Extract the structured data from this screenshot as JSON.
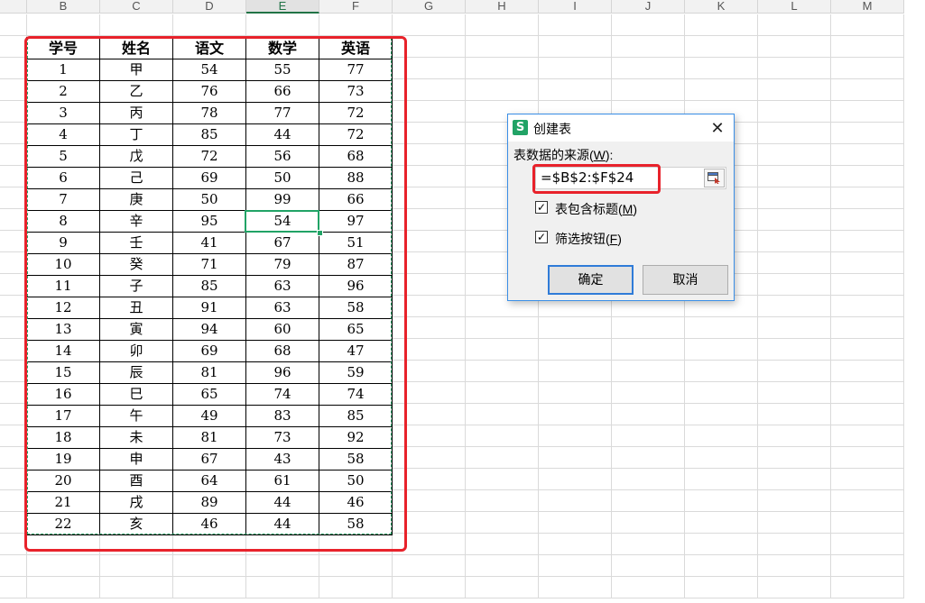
{
  "columns": [
    "B",
    "C",
    "D",
    "E",
    "F",
    "G",
    "H",
    "I",
    "J",
    "K",
    "L",
    "M"
  ],
  "active_column": "E",
  "table": {
    "headers": [
      "学号",
      "姓名",
      "语文",
      "数学",
      "英语"
    ],
    "rows": [
      [
        "1",
        "甲",
        "54",
        "55",
        "77"
      ],
      [
        "2",
        "乙",
        "76",
        "66",
        "73"
      ],
      [
        "3",
        "丙",
        "78",
        "77",
        "72"
      ],
      [
        "4",
        "丁",
        "85",
        "44",
        "72"
      ],
      [
        "5",
        "戊",
        "72",
        "56",
        "68"
      ],
      [
        "6",
        "己",
        "69",
        "50",
        "88"
      ],
      [
        "7",
        "庚",
        "50",
        "99",
        "66"
      ],
      [
        "8",
        "辛",
        "95",
        "54",
        "97"
      ],
      [
        "9",
        "壬",
        "41",
        "67",
        "51"
      ],
      [
        "10",
        "癸",
        "71",
        "79",
        "87"
      ],
      [
        "11",
        "子",
        "85",
        "63",
        "96"
      ],
      [
        "12",
        "丑",
        "91",
        "63",
        "58"
      ],
      [
        "13",
        "寅",
        "94",
        "60",
        "65"
      ],
      [
        "14",
        "卯",
        "69",
        "68",
        "47"
      ],
      [
        "15",
        "辰",
        "81",
        "96",
        "59"
      ],
      [
        "16",
        "巳",
        "65",
        "74",
        "74"
      ],
      [
        "17",
        "午",
        "49",
        "83",
        "85"
      ],
      [
        "18",
        "未",
        "81",
        "73",
        "92"
      ],
      [
        "19",
        "申",
        "67",
        "43",
        "58"
      ],
      [
        "20",
        "酉",
        "64",
        "61",
        "50"
      ],
      [
        "21",
        "戌",
        "89",
        "44",
        "46"
      ],
      [
        "22",
        "亥",
        "46",
        "44",
        "58"
      ]
    ]
  },
  "dialog": {
    "title": "创建表",
    "app_icon": "S",
    "close_symbol": "✕",
    "source_label": "表数据的来源(W):",
    "source_label_main": "表数据的来源(",
    "source_label_key": "W",
    "source_label_tail": "):",
    "source_value": "=$B$2:$F$24",
    "has_header_main": "表包含标题(",
    "has_header_key": "M",
    "has_header_tail": ")",
    "has_header_checked": true,
    "filter_main": "筛选按钮(",
    "filter_key": "F",
    "filter_tail": ")",
    "filter_checked": true,
    "ok_label": "确定",
    "cancel_label": "取消",
    "check_mark": "✓"
  },
  "colors": {
    "highlight_red": "#e8222b",
    "selection_green": "#21a366",
    "dialog_border": "#3a8ee6"
  }
}
